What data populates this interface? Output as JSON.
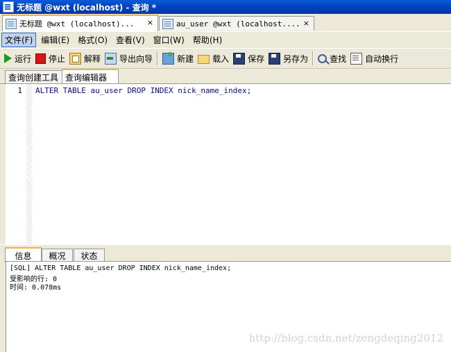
{
  "window": {
    "title": "无标题 @wxt (localhost) - 查询 *"
  },
  "doc_tabs": [
    {
      "label": "无标题 @wxt (localhost)...",
      "close": "×"
    },
    {
      "label": "au_user @wxt (localhost....",
      "close": "×"
    }
  ],
  "menu": [
    "文件(F)",
    "编辑(E)",
    "格式(O)",
    "查看(V)",
    "窗口(W)",
    "帮助(H)"
  ],
  "toolbar": {
    "run": "运行",
    "stop": "停止",
    "explain": "解释",
    "export_wizard": "导出向导",
    "new": "新建",
    "load": "载入",
    "save": "保存",
    "save_as": "另存为",
    "find": "查找",
    "word_wrap": "自动换行"
  },
  "sub_tabs": [
    "查询创建工具",
    "查询编辑器"
  ],
  "editor": {
    "line_number": "1",
    "code": "ALTER TABLE au_user DROP INDEX nick_name_index;"
  },
  "bottom_tabs": [
    "信息",
    "概况",
    "状态"
  ],
  "messages": [
    "[SQL] ALTER TABLE au_user DROP INDEX nick_name_index;",
    "受影响的行: 0",
    "时间: 0.078ms"
  ],
  "watermark": "http://blog.csdn.net/zengdeqing2012",
  "colors": {
    "title_bar": "#0343c2",
    "active_tab_accent": "#f5b43c",
    "chrome": "#ece9d8"
  }
}
